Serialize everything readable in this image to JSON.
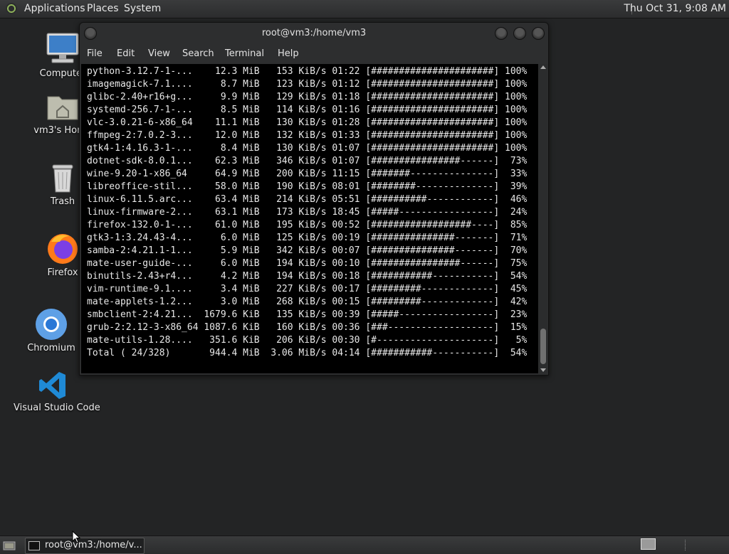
{
  "top_panel": {
    "menus": [
      "Applications",
      "Places",
      "System"
    ],
    "clock": "Thu Oct 31,  9:08 AM"
  },
  "desktop": {
    "icons": [
      {
        "label": "Computer",
        "icon": "computer-icon"
      },
      {
        "label": "vm3's Home",
        "icon": "home-folder-icon"
      },
      {
        "label": "Trash",
        "icon": "trash-icon"
      },
      {
        "label": "Firefox",
        "icon": "firefox-icon"
      },
      {
        "label": "Chromium",
        "icon": "chromium-icon"
      },
      {
        "label": "Visual Studio Code",
        "icon": "vscode-icon"
      }
    ]
  },
  "terminal": {
    "title": "root@vm3:/home/vm3",
    "menu": [
      "File",
      "Edit",
      "View",
      "Search",
      "Terminal",
      "Help"
    ],
    "lines": [
      "python-3.12.7-1-...    12.3 MiB   153 KiB/s 01:22 [######################] 100%",
      "imagemagick-7.1....     8.7 MiB   123 KiB/s 01:12 [######################] 100%",
      "glibc-2.40+r16+g...     9.9 MiB   129 KiB/s 01:18 [######################] 100%",
      "systemd-256.7-1-...     8.5 MiB   114 KiB/s 01:16 [######################] 100%",
      "vlc-3.0.21-6-x86_64    11.1 MiB   130 KiB/s 01:28 [######################] 100%",
      "ffmpeg-2:7.0.2-3...    12.0 MiB   132 KiB/s 01:33 [######################] 100%",
      "gtk4-1:4.16.3-1-...     8.4 MiB   130 KiB/s 01:07 [######################] 100%",
      "dotnet-sdk-8.0.1...    62.3 MiB   346 KiB/s 01:07 [################------]  73%",
      "wine-9.20-1-x86_64     64.9 MiB   200 KiB/s 11:15 [#######---------------]  33%",
      "libreoffice-stil...    58.0 MiB   190 KiB/s 08:01 [########--------------]  39%",
      "linux-6.11.5.arc...    63.4 MiB   214 KiB/s 05:51 [##########------------]  46%",
      "linux-firmware-2...    63.1 MiB   173 KiB/s 18:45 [#####-----------------]  24%",
      "firefox-132.0-1-...    61.0 MiB   195 KiB/s 00:52 [##################----]  85%",
      "gtk3-1:3.24.43-4...     6.0 MiB   125 KiB/s 00:19 [###############-------]  71%",
      "samba-2:4.21.1-1...     5.9 MiB   342 KiB/s 00:07 [###############-------]  70%",
      "mate-user-guide-...     6.0 MiB   194 KiB/s 00:10 [################------]  75%",
      "binutils-2.43+r4...     4.2 MiB   194 KiB/s 00:18 [###########-----------]  54%",
      "vim-runtime-9.1....     3.4 MiB   227 KiB/s 00:17 [#########-------------]  45%",
      "mate-applets-1.2...     3.0 MiB   268 KiB/s 00:15 [#########-------------]  42%",
      "smbclient-2:4.21...  1679.6 KiB   135 KiB/s 00:39 [#####-----------------]  23%",
      "grub-2:2.12-3-x86_64 1087.6 KiB   160 KiB/s 00:36 [###-------------------]  15%",
      "mate-utils-1.28....   351.6 KiB   206 KiB/s 00:30 [#---------------------]   5%",
      "Total ( 24/328)       944.4 MiB  3.06 MiB/s 04:14 [###########-----------]  54%"
    ]
  },
  "taskbar": {
    "window_label": "root@vm3:/home/v..."
  }
}
